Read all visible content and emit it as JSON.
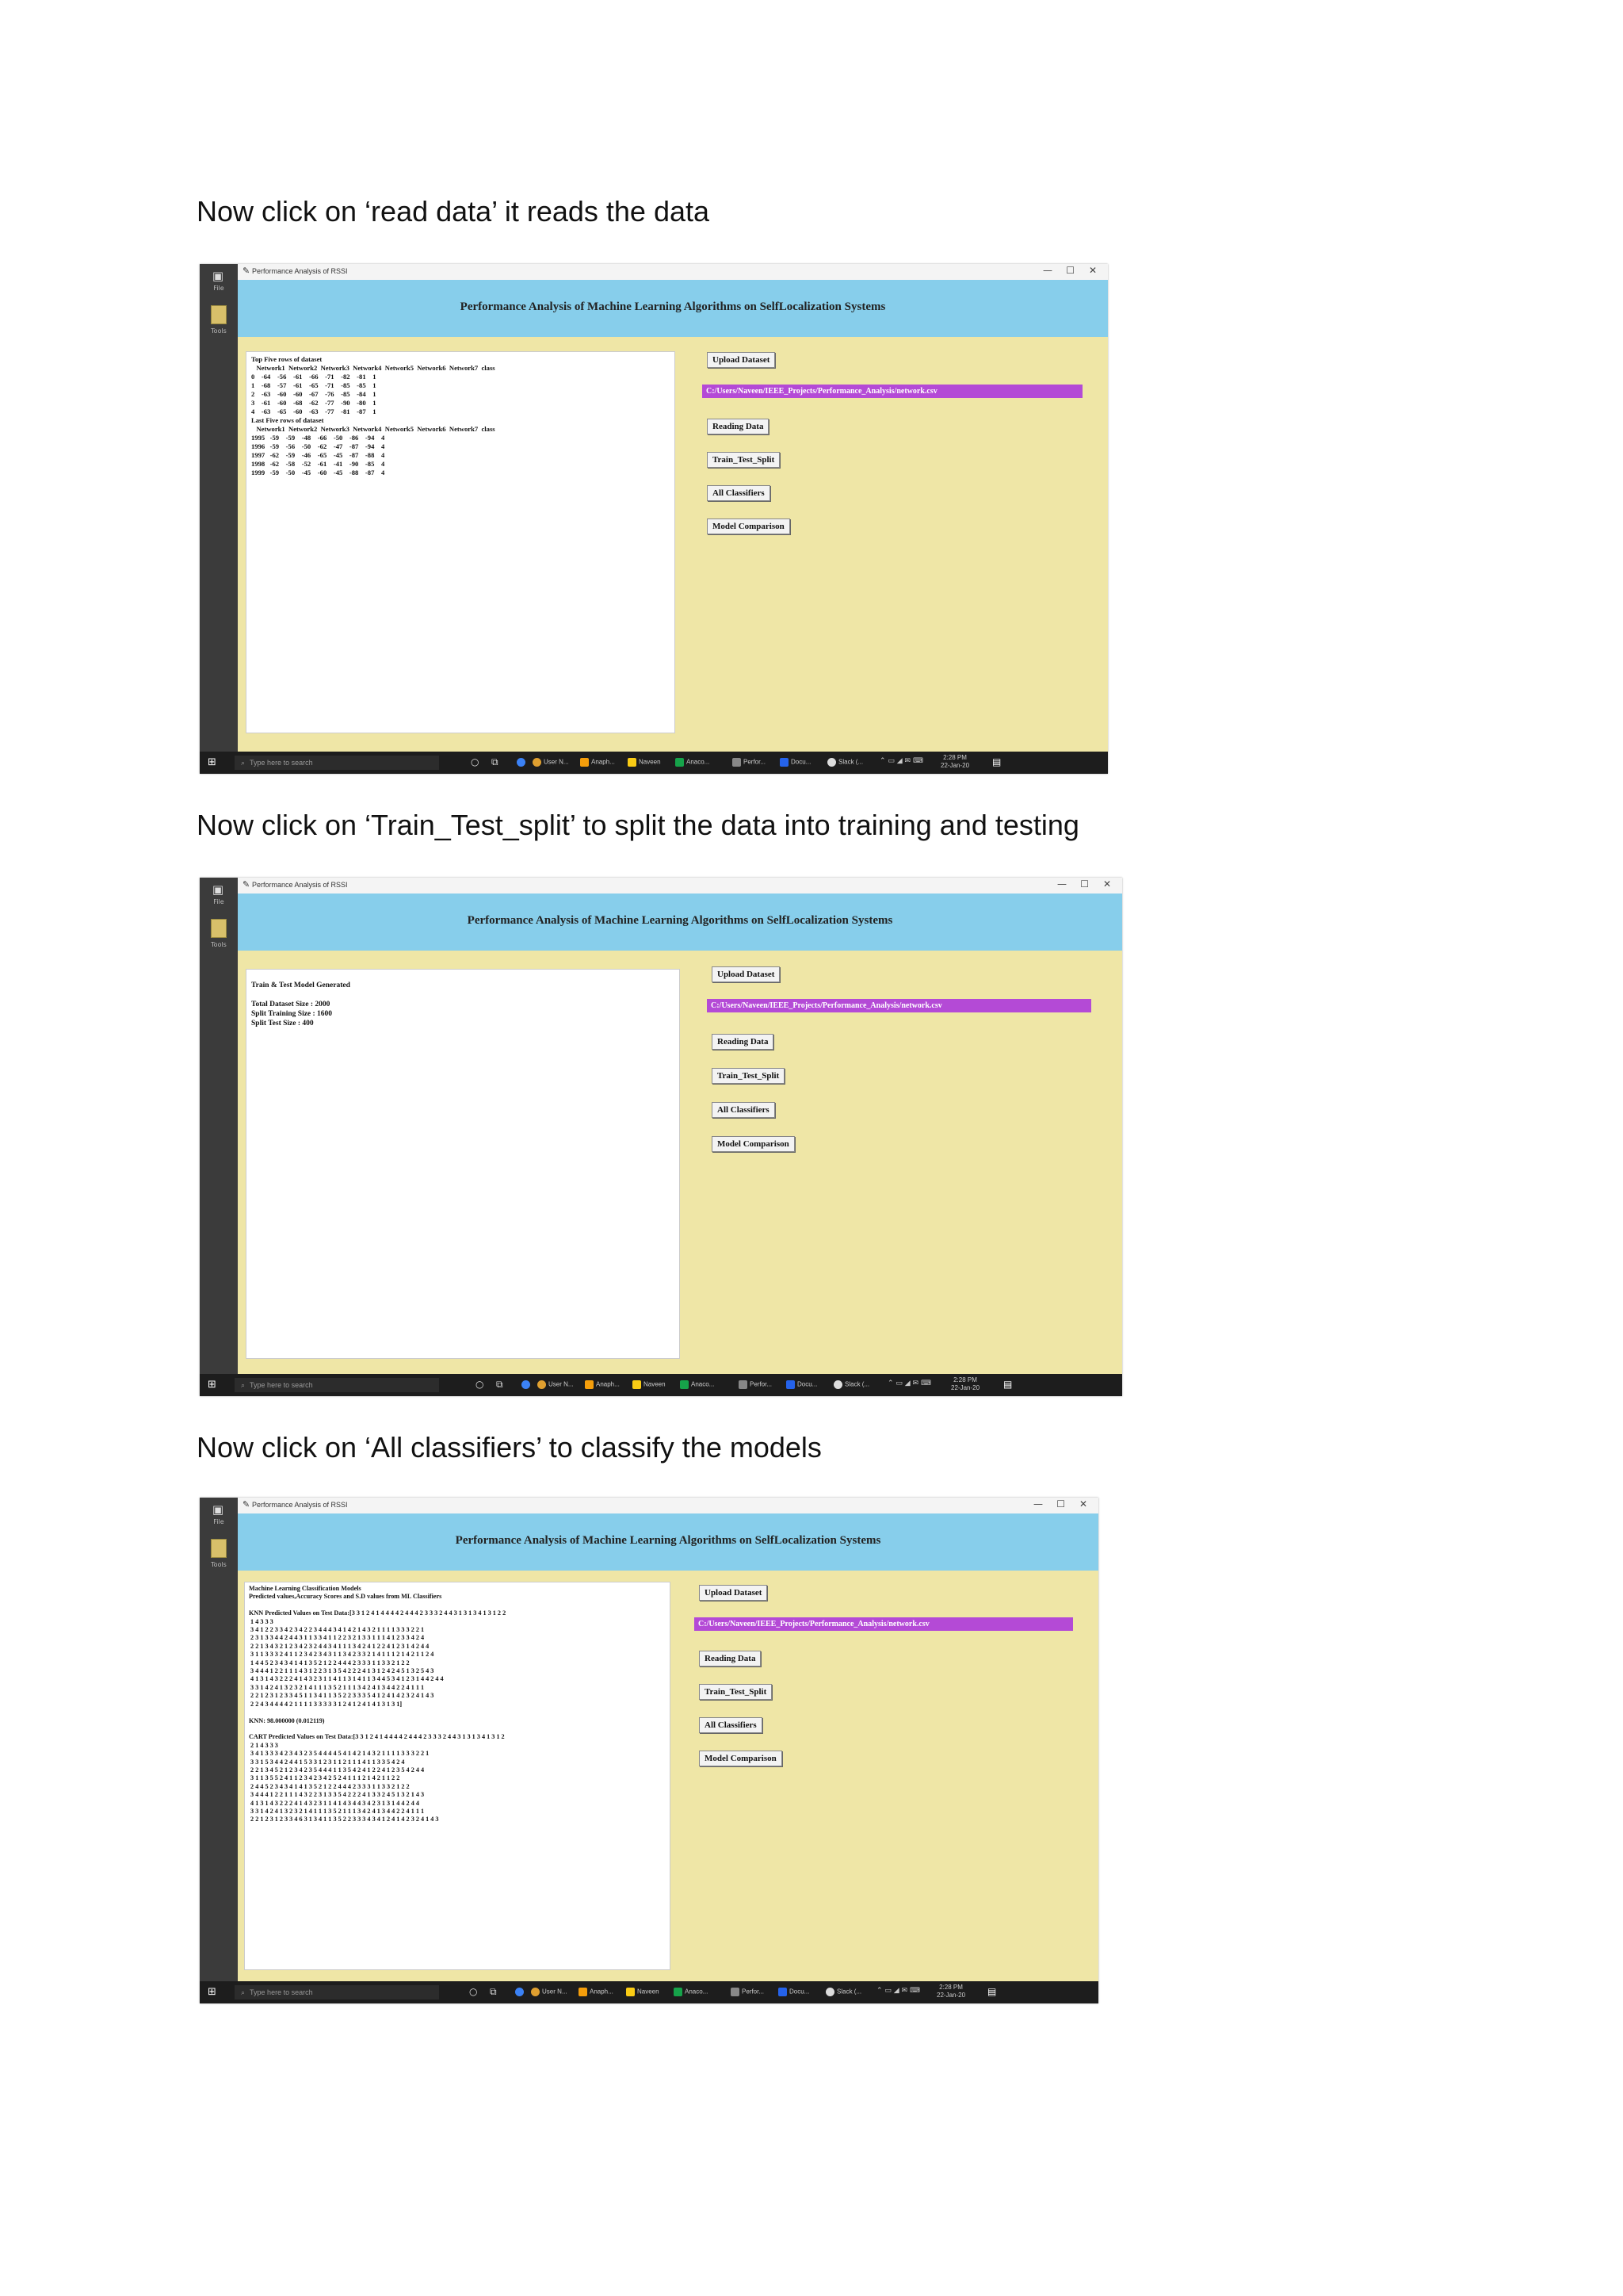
{
  "captions": [
    "Now click on ‘read data’ it reads the data",
    "Now click on ‘Train_Test_split’ to split the data into training and testing",
    "Now click on ‘All classifiers’ to classify the models"
  ],
  "app": {
    "window_title": "Performance Analysis of RSSI",
    "banner_title": "Performance Analysis of Machine Learning Algorithms on SelfLocalization Systems",
    "sidebar_labels": [
      "File",
      "Tools"
    ],
    "window_controls": [
      "—",
      "☐",
      "✕"
    ],
    "buttons": {
      "upload": "Upload Dataset",
      "reading": "Reading Data",
      "split": "Train_Test_Split",
      "classifiers": "All Classifiers",
      "comparison": "Model Comparison"
    },
    "dataset_path": "C:/Users/Naveen/IEEE_Projects/Performance_Analysis/network.csv",
    "taskbar": {
      "search_placeholder": "Type here to search",
      "apps": [
        "User N...",
        "Anaph...",
        "Naveen",
        "Anaco...",
        "Perfor...",
        "Docu...",
        "Slack (..."
      ],
      "time": "2:28 PM",
      "date": "22-Jan-20"
    }
  },
  "screens": [
    {
      "output": "Top Five rows of dataset\n   Network1  Network2  Network3  Network4  Network5  Network6  Network7  class\n0    -64    -56    -61    -66    -71    -82    -81    1\n1    -68    -57    -61    -65    -71    -85    -85    1\n2    -63    -60    -60    -67    -76    -85    -84    1\n3    -61    -60    -68    -62    -77    -90    -80    1\n4    -63    -65    -60    -63    -77    -81    -87    1\nLast Five rows of dataset\n   Network1  Network2  Network3  Network4  Network5  Network6  Network7  class\n1995   -59    -59    -48    -66    -50    -86    -94    4\n1996   -59    -56    -50    -62    -47    -87    -94    4\n1997   -62    -59    -46    -65    -45    -87    -88    4\n1998   -62    -58    -52    -61    -41    -90    -85    4\n1999   -59    -50    -45    -60    -45    -88    -87    4"
    },
    {
      "output": "Train & Test Model Generated\n\nTotal Dataset Size : 2000\nSplit Training Size : 1600\nSplit Test Size : 400"
    },
    {
      "output": "Machine Learning Classification Models\nPredicted values,Accuracy Scores and S.D values from ML Classifiers\n\nKNN Predicted Values on Test Data:[3 3 1 2 4 1 4 4 4 4 2 4 4 4 2 3 3 3 2 4 4 3 1 3 1 3 4 1 3 1 2 2\n 1 4 3 3 3\n 3 4 1 2 2 3 3 4 2 3 4 2 2 3 4 4 4 3 4 1 4 2 1 4 3 2 1 1 1 1 3 3 3 2 2 1\n 2 3 1 3 3 4 4 2 4 4 3 1 1 3 3 4 1 1 2 2 3 2 1 3 3 1 1 1 4 1 2 3 3 4 2 4\n 2 2 1 3 4 3 2 1 2 3 4 2 3 2 4 4 3 4 1 1 1 3 4 2 4 1 2 2 4 1 2 3 1 4 2 4 4\n 3 1 1 3 3 3 2 4 1 1 2 3 4 2 3 4 3 1 1 3 4 2 3 3 2 1 4 1 1 1 2 1 4 2 1 1 2 4\n 1 4 4 5 2 3 4 3 4 1 4 1 3 5 2 1 2 2 4 4 4 2 3 3 3 1 1 3 3 2 1 2 2\n 3 4 4 4 1 2 2 1 1 1 4 3 1 2 2 3 1 3 5 4 2 2 2 4 1 3 1 2 4 2 4 5 1 3 2 5 4 3\n 4 1 3 1 4 3 2 2 2 4 1 4 3 2 3 1 1 4 1 1 3 1 4 1 1 3 4 4 5 3 4 1 2 3 1 4 4 2 4 4\n 3 3 1 4 2 4 1 3 2 3 2 1 4 1 1 1 3 5 2 1 1 1 3 4 2 4 1 3 4 4 2 2 4 1 1 1\n 2 2 1 2 3 1 2 3 3 4 5 1 1 3 4 1 1 3 5 2 2 3 3 3 5 4 1 2 4 1 4 2 3 2 4 1 4 3\n 2 2 4 3 4 4 4 4 2 1 1 1 1 3 3 3 3 3 1 2 4 1 2 4 1 4 1 3 1 3 1]\n\nKNN: 98.000000 (0.012119)\n\nCART Predicted Values on Test Data:[3 3 1 2 4 1 4 4 4 4 2 4 4 4 2 3 3 3 2 4 4 3 1 3 1 3 4 1 3 1 2\n 2 1 4 3 3 3\n 3 4 1 3 3 3 4 2 3 4 3 2 3 5 4 4 4 4 5 4 1 4 2 1 4 3 2 1 1 1 1 3 3 3 2 2 1\n 3 3 1 5 3 4 4 2 4 4 1 5 3 3 1 2 3 1 1 2 1 1 1 4 1 1 3 3 5 4 2 4\n 2 2 1 3 4 5 2 1 2 3 4 2 3 5 4 4 4 1 1 3 5 4 2 4 1 2 2 4 1 2 3 5 4 2 4 4\n 3 1 1 3 5 5 2 4 1 1 2 3 4 2 3 4 2 5 2 4 1 1 1 2 1 4 2 1 1 2 2\n 2 4 4 5 2 3 4 3 4 1 4 1 3 5 2 1 2 2 4 4 4 2 3 3 3 1 1 3 3 2 1 2 2\n 3 4 4 4 1 2 2 1 1 1 4 3 2 2 3 1 3 3 5 4 2 2 2 4 1 3 3 2 4 5 1 3 2 1 4 3\n 4 1 3 1 4 3 2 2 2 4 1 4 3 2 3 1 1 4 1 4 3 4 4 3 4 2 3 1 3 1 4 4 2 4 4\n 3 3 1 4 2 4 1 3 2 3 2 1 4 1 1 1 3 5 2 1 1 1 3 4 2 4 1 3 4 4 2 2 4 1 1 1\n 2 2 1 2 3 1 2 3 3 4 6 3 1 3 4 1 1 3 5 2 2 3 3 3 4 3 4 1 2 4 1 4 2 3 2 4 1 4 3"
    }
  ]
}
